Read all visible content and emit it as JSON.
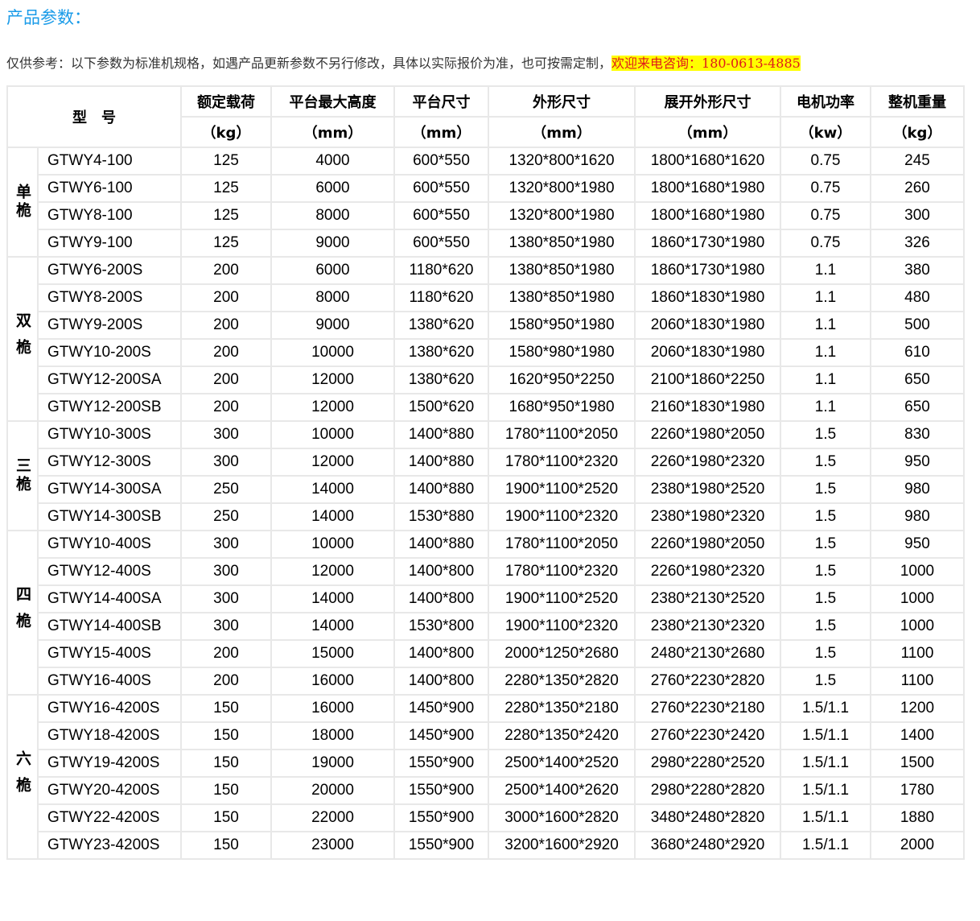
{
  "title": "产品参数：",
  "note": {
    "text": "仅供参考：以下参数为标准机规格，如遇产品更新参数不另行修改，具体以实际报价为准，也可按需定制，",
    "highlight": "欢迎来电咨询：180-0613-4885"
  },
  "table": {
    "model_header": "型　号",
    "headers": [
      "额定载荷",
      "平台最大高度",
      "平台尺寸",
      "外形尺寸",
      "展开外形尺寸",
      "电机功率",
      "整机重量"
    ],
    "units": [
      "（kg）",
      "（mm）",
      "（mm）",
      "（mm）",
      "（mm）",
      "（kw）",
      "（kg）"
    ],
    "groups": [
      {
        "label": "单桅",
        "rows": [
          [
            "GTWY4-100",
            "125",
            "4000",
            "600*550",
            "1320*800*1620",
            "1800*1680*1620",
            "0.75",
            "245"
          ],
          [
            "GTWY6-100",
            "125",
            "6000",
            "600*550",
            "1320*800*1980",
            "1800*1680*1980",
            "0.75",
            "260"
          ],
          [
            "GTWY8-100",
            "125",
            "8000",
            "600*550",
            "1320*800*1980",
            "1800*1680*1980",
            "0.75",
            "300"
          ],
          [
            "GTWY9-100",
            "125",
            "9000",
            "600*550",
            "1380*850*1980",
            "1860*1730*1980",
            "0.75",
            "326"
          ]
        ]
      },
      {
        "label": "双桅",
        "rows": [
          [
            "GTWY6-200S",
            "200",
            "6000",
            "1180*620",
            "1380*850*1980",
            "1860*1730*1980",
            "1.1",
            "380"
          ],
          [
            "GTWY8-200S",
            "200",
            "8000",
            "1180*620",
            "1380*850*1980",
            "1860*1830*1980",
            "1.1",
            "480"
          ],
          [
            "GTWY9-200S",
            "200",
            "9000",
            "1380*620",
            "1580*950*1980",
            "2060*1830*1980",
            "1.1",
            "500"
          ],
          [
            "GTWY10-200S",
            "200",
            "10000",
            "1380*620",
            "1580*980*1980",
            "2060*1830*1980",
            "1.1",
            "610"
          ],
          [
            "GTWY12-200SA",
            "200",
            "12000",
            "1380*620",
            "1620*950*2250",
            "2100*1860*2250",
            "1.1",
            "650"
          ],
          [
            "GTWY12-200SB",
            "200",
            "12000",
            "1500*620",
            "1680*950*1980",
            "2160*1830*1980",
            "1.1",
            "650"
          ]
        ]
      },
      {
        "label": "三桅",
        "rows": [
          [
            "GTWY10-300S",
            "300",
            "10000",
            "1400*880",
            "1780*1100*2050",
            "2260*1980*2050",
            "1.5",
            "830"
          ],
          [
            "GTWY12-300S",
            "300",
            "12000",
            "1400*880",
            "1780*1100*2320",
            "2260*1980*2320",
            "1.5",
            "950"
          ],
          [
            "GTWY14-300SA",
            "250",
            "14000",
            "1400*880",
            "1900*1100*2520",
            "2380*1980*2520",
            "1.5",
            "980"
          ],
          [
            "GTWY14-300SB",
            "250",
            "14000",
            "1530*880",
            "1900*1100*2320",
            "2380*1980*2320",
            "1.5",
            "980"
          ]
        ]
      },
      {
        "label": "四桅",
        "rows": [
          [
            "GTWY10-400S",
            "300",
            "10000",
            "1400*880",
            "1780*1100*2050",
            "2260*1980*2050",
            "1.5",
            "950"
          ],
          [
            "GTWY12-400S",
            "300",
            "12000",
            "1400*800",
            "1780*1100*2320",
            "2260*1980*2320",
            "1.5",
            "1000"
          ],
          [
            "GTWY14-400SA",
            "300",
            "14000",
            "1400*800",
            "1900*1100*2520",
            "2380*2130*2520",
            "1.5",
            "1000"
          ],
          [
            "GTWY14-400SB",
            "300",
            "14000",
            "1530*800",
            "1900*1100*2320",
            "2380*2130*2320",
            "1.5",
            "1000"
          ],
          [
            "GTWY15-400S",
            "200",
            "15000",
            "1400*800",
            "2000*1250*2680",
            "2480*2130*2680",
            "1.5",
            "1100"
          ],
          [
            "GTWY16-400S",
            "200",
            "16000",
            "1400*800",
            "2280*1350*2820",
            "2760*2230*2820",
            "1.5",
            "1100"
          ]
        ]
      },
      {
        "label": "六桅",
        "rows": [
          [
            "GTWY16-4200S",
            "150",
            "16000",
            "1450*900",
            "2280*1350*2180",
            "2760*2230*2180",
            "1.5/1.1",
            "1200"
          ],
          [
            "GTWY18-4200S",
            "150",
            "18000",
            "1450*900",
            "2280*1350*2420",
            "2760*2230*2420",
            "1.5/1.1",
            "1400"
          ],
          [
            "GTWY19-4200S",
            "150",
            "19000",
            "1550*900",
            "2500*1400*2520",
            "2980*2280*2520",
            "1.5/1.1",
            "1500"
          ],
          [
            "GTWY20-4200S",
            "150",
            "20000",
            "1550*900",
            "2500*1400*2620",
            "2980*2280*2820",
            "1.5/1.1",
            "1780"
          ],
          [
            "GTWY22-4200S",
            "150",
            "22000",
            "1550*900",
            "3000*1600*2820",
            "3480*2480*2820",
            "1.5/1.1",
            "1880"
          ],
          [
            "GTWY23-4200S",
            "150",
            "23000",
            "1550*900",
            "3200*1600*2920",
            "3680*2480*2920",
            "1.5/1.1",
            "2000"
          ]
        ]
      }
    ]
  }
}
